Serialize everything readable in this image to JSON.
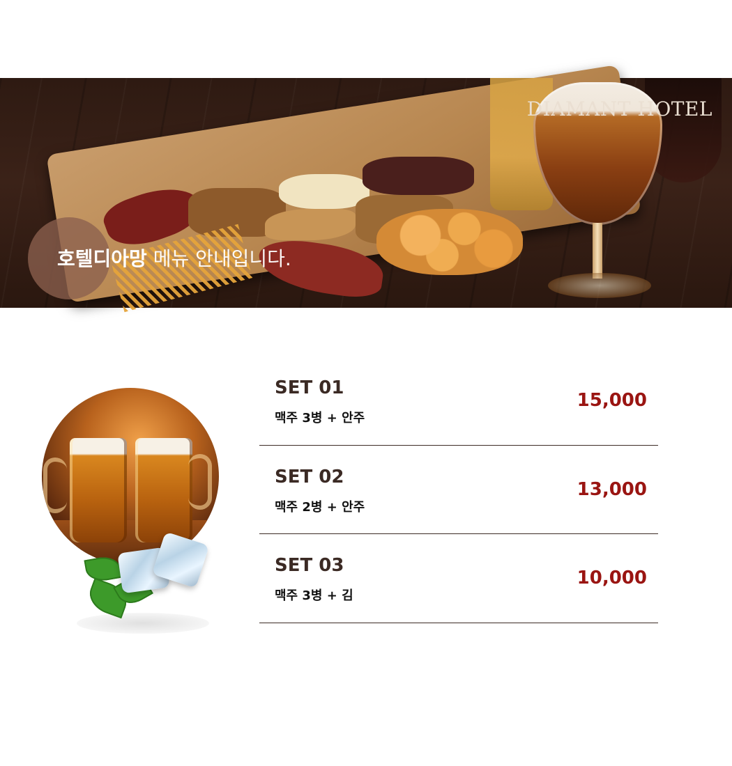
{
  "banner": {
    "brand": "DIAMANT HOTEL",
    "tagline_bold": "호텔디아망",
    "tagline_rest": " 메뉴 안내입니다."
  },
  "menu": {
    "items": [
      {
        "name": "SET 01",
        "desc": "맥주 3병 + 안주",
        "price": "15,000"
      },
      {
        "name": "SET 02",
        "desc": "맥주 2병 + 안주",
        "price": "13,000"
      },
      {
        "name": "SET 03",
        "desc": "맥주 3병 + 김",
        "price": "10,000"
      }
    ]
  },
  "colors": {
    "price": "#9a1512",
    "heading": "#3b2a24",
    "divider": "#3b2a24"
  }
}
